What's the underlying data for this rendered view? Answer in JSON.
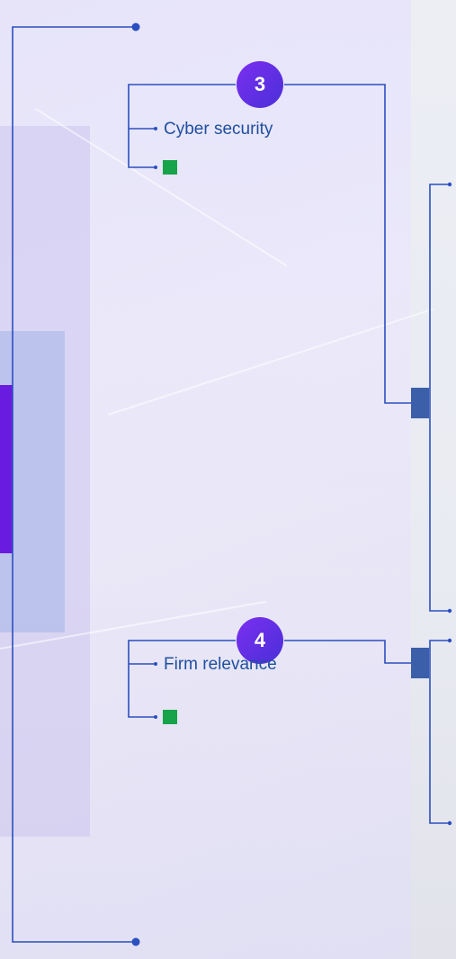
{
  "sections": [
    {
      "number": "3",
      "label": "Cyber security",
      "status_color": "#16a34a"
    },
    {
      "number": "4",
      "label": "Firm relevance",
      "status_color": "#16a34a"
    }
  ],
  "colors": {
    "line": "#2b4fc0",
    "connector": "#3b5fa8",
    "badge_start": "#7b2ff0",
    "badge_end": "#4a2fd8",
    "accent_bar": "#6a1be0",
    "status": "#16a34a"
  }
}
